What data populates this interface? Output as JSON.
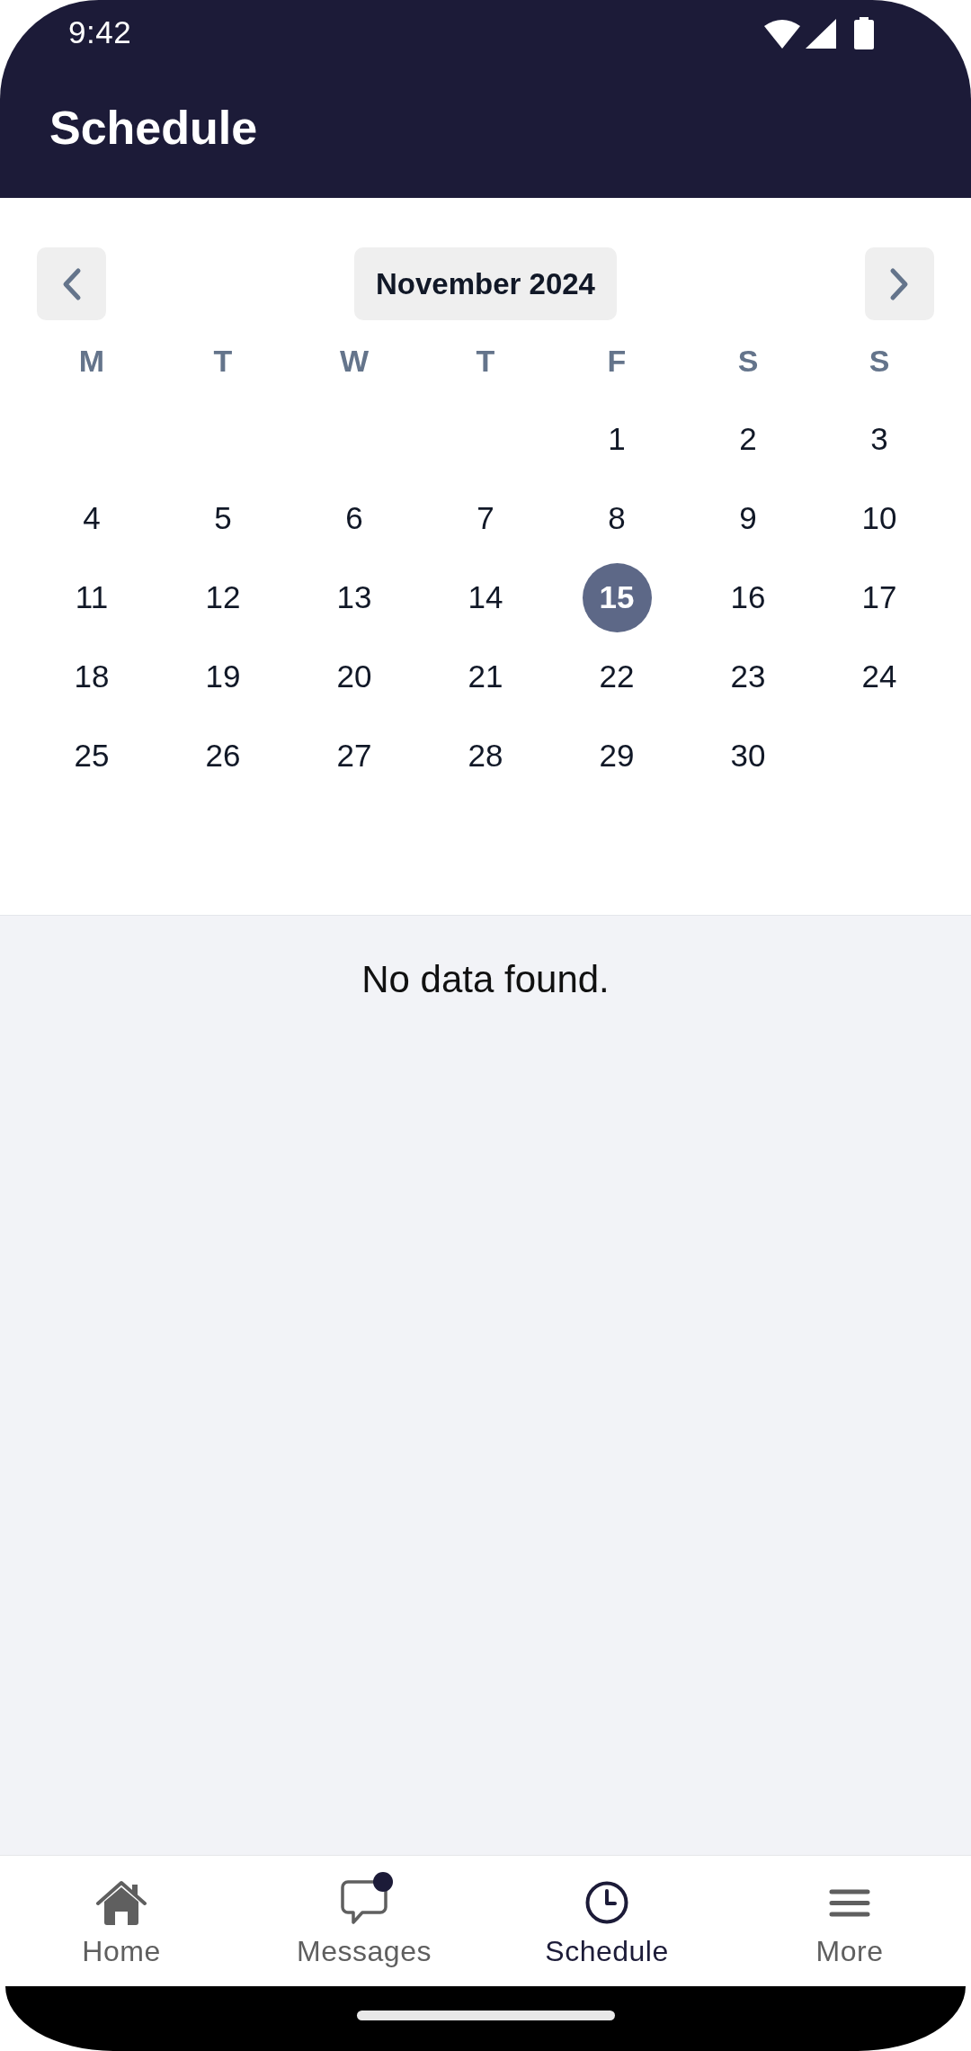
{
  "status_bar": {
    "time": "9:42"
  },
  "header": {
    "title": "Schedule"
  },
  "calendar": {
    "month_label": "November 2024",
    "weekdays": [
      "M",
      "T",
      "W",
      "T",
      "F",
      "S",
      "S"
    ],
    "weeks": [
      {
        "days": [
          {
            "label": "1",
            "selected": false
          },
          {
            "label": "2",
            "selected": false
          },
          {
            "label": "3",
            "selected": false
          }
        ]
      },
      {
        "days": [
          {
            "label": "4",
            "selected": false
          },
          {
            "label": "5",
            "selected": false
          },
          {
            "label": "6",
            "selected": false
          },
          {
            "label": "7",
            "selected": false
          },
          {
            "label": "8",
            "selected": false
          },
          {
            "label": "9",
            "selected": false
          },
          {
            "label": "10",
            "selected": false
          }
        ]
      },
      {
        "days": [
          {
            "label": "11",
            "selected": false
          },
          {
            "label": "12",
            "selected": false
          },
          {
            "label": "13",
            "selected": false
          },
          {
            "label": "14",
            "selected": false
          },
          {
            "label": "15",
            "selected": true
          },
          {
            "label": "16",
            "selected": false
          },
          {
            "label": "17",
            "selected": false
          }
        ]
      },
      {
        "days": [
          {
            "label": "18",
            "selected": false
          },
          {
            "label": "19",
            "selected": false
          },
          {
            "label": "20",
            "selected": false
          },
          {
            "label": "21",
            "selected": false
          },
          {
            "label": "22",
            "selected": false
          },
          {
            "label": "23",
            "selected": false
          },
          {
            "label": "24",
            "selected": false
          }
        ]
      },
      {
        "days": [
          {
            "label": "25",
            "selected": false
          },
          {
            "label": "26",
            "selected": false
          },
          {
            "label": "27",
            "selected": false
          },
          {
            "label": "28",
            "selected": false
          },
          {
            "label": "29",
            "selected": false
          },
          {
            "label": "30",
            "selected": false
          }
        ]
      }
    ]
  },
  "empty_state": {
    "message": "No data found."
  },
  "bottom_nav": [
    {
      "label": "Home",
      "selected": false,
      "badge": false
    },
    {
      "label": "Messages",
      "selected": false,
      "badge": true
    },
    {
      "label": "Schedule",
      "selected": true,
      "badge": false
    },
    {
      "label": "More",
      "selected": false,
      "badge": false
    }
  ]
}
